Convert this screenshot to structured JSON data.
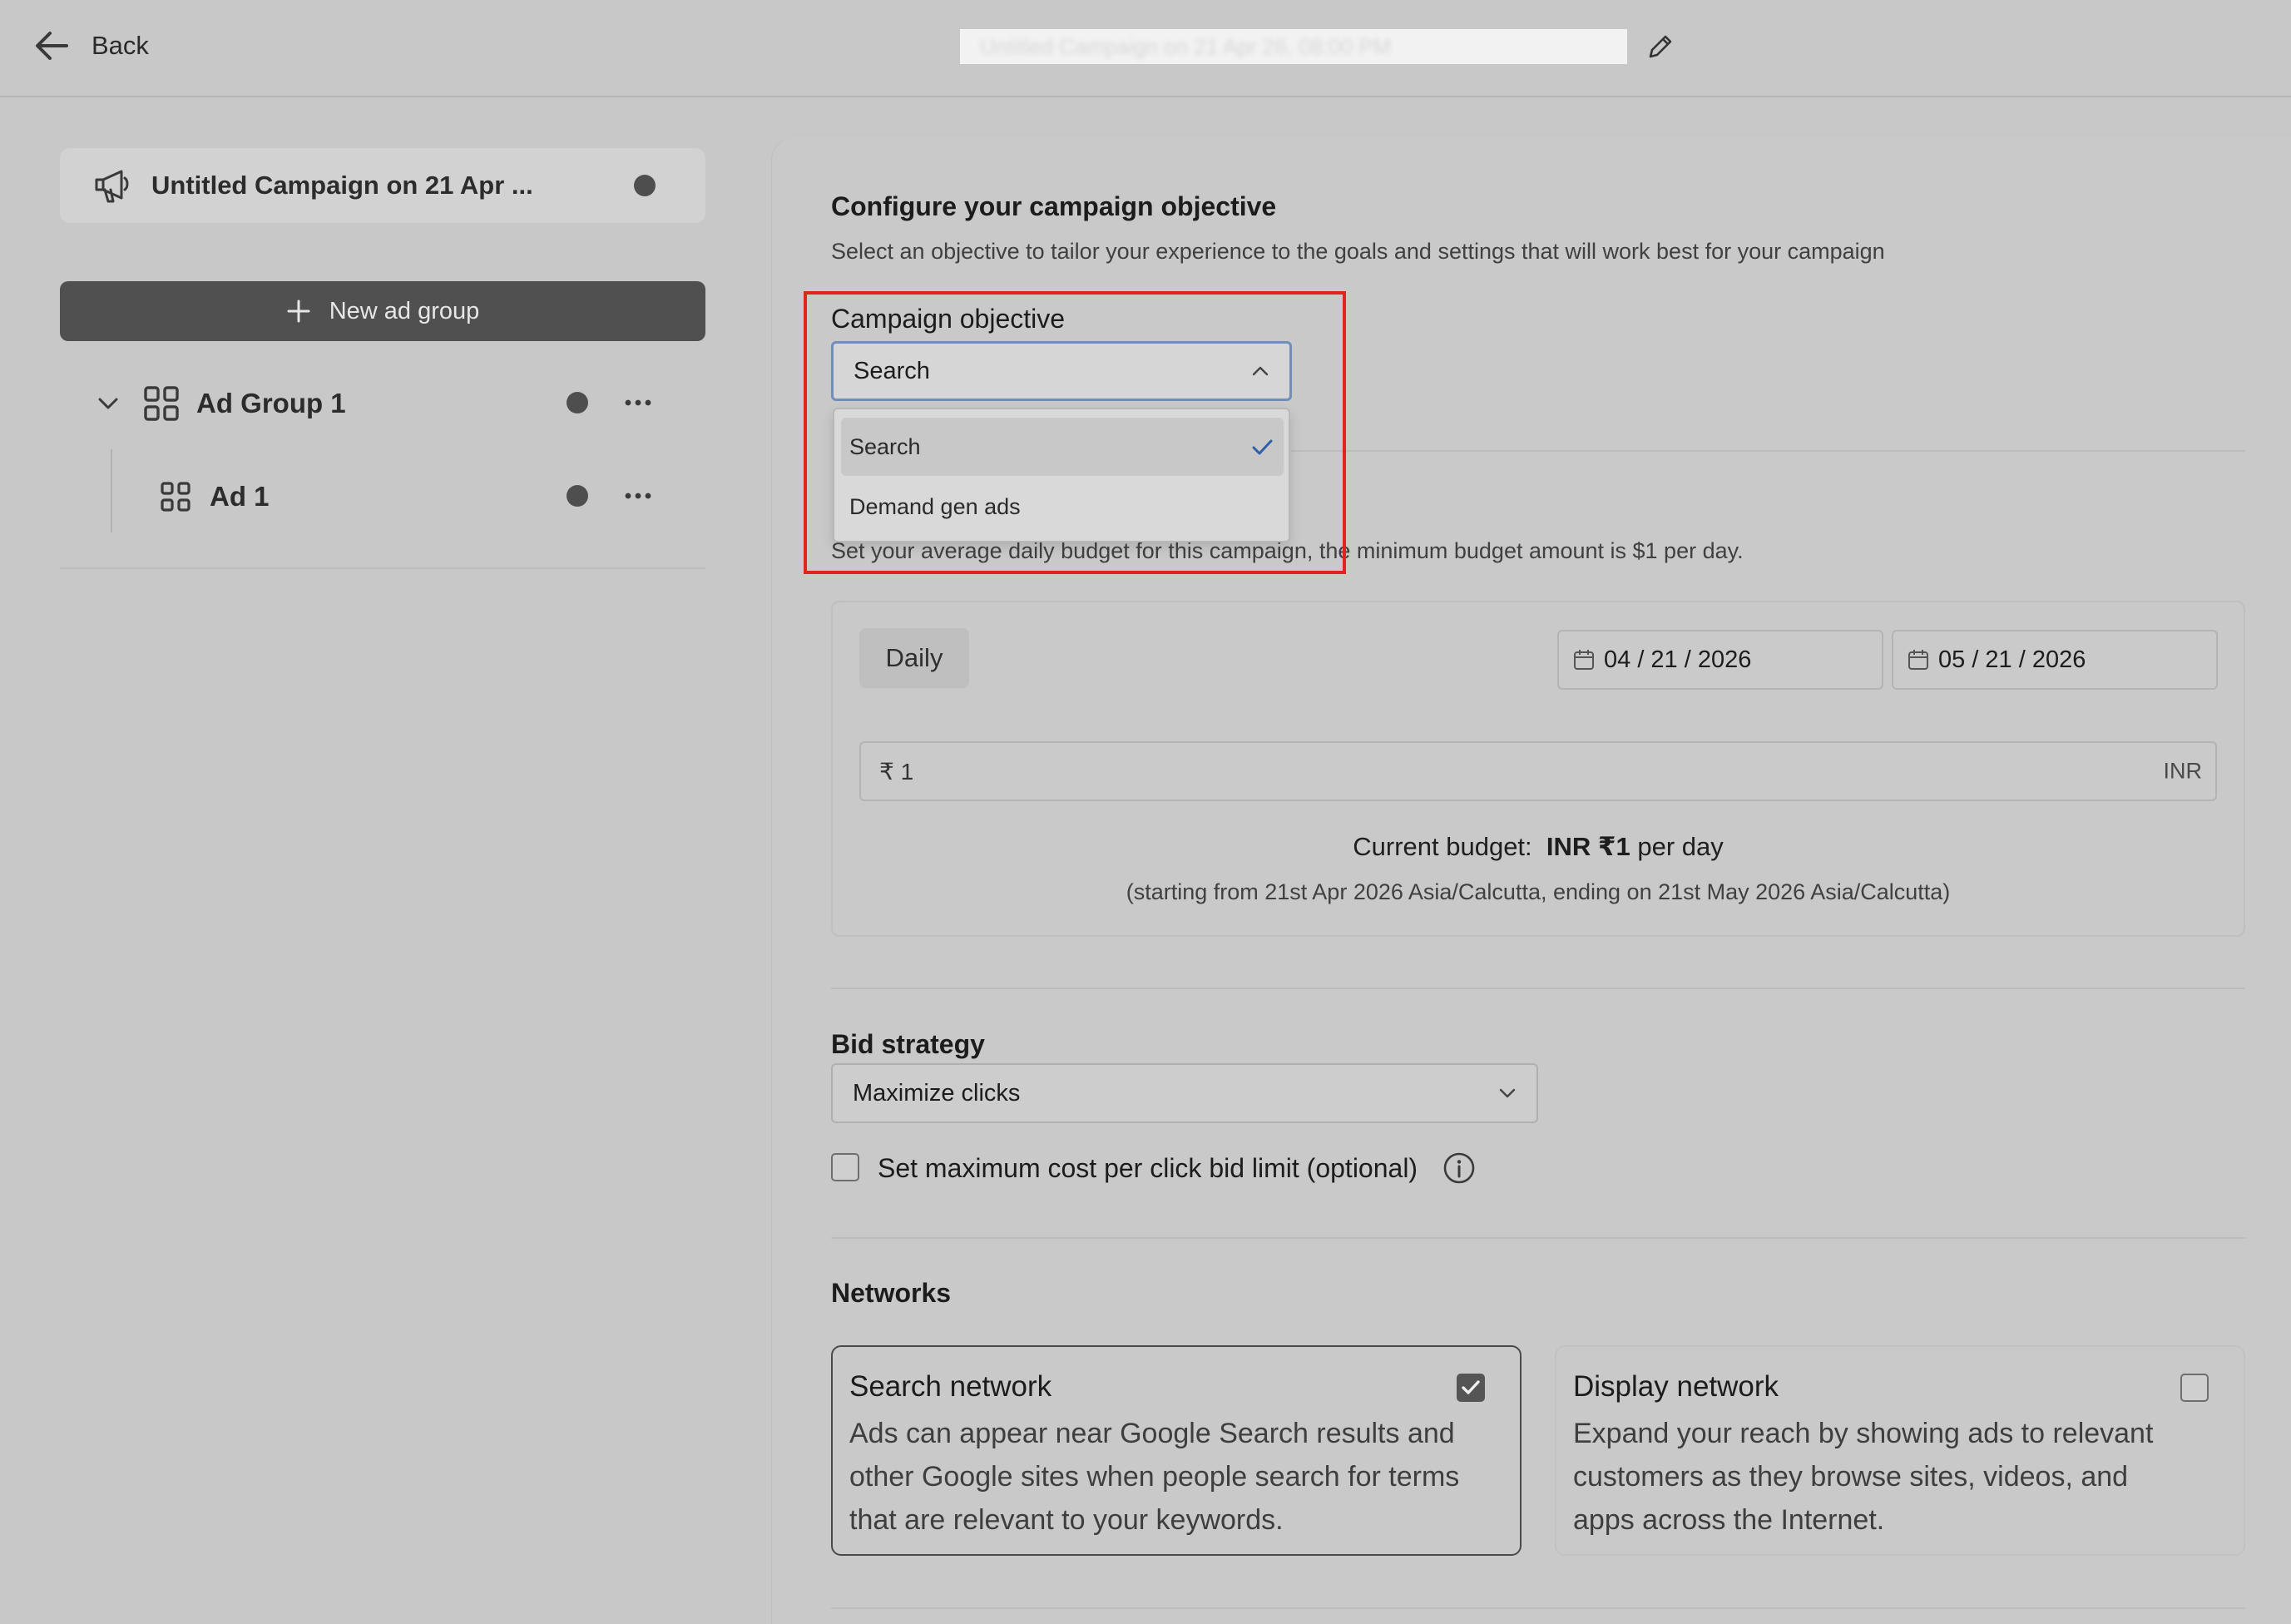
{
  "topbar": {
    "back_label": "Back",
    "blurred_title": "Untitled Campaign on 21 Apr 26, 08:00 PM"
  },
  "sidebar": {
    "campaign_name": "Untitled Campaign on 21 Apr ...",
    "new_ad_group_label": "New ad group",
    "ad_group": {
      "label": "Ad Group 1"
    },
    "ad": {
      "label": "Ad 1"
    }
  },
  "objective": {
    "heading": "Configure your campaign objective",
    "description": "Select an objective to tailor your experience to the goals and settings that will work best for your campaign",
    "field_label": "Campaign objective",
    "selected_value": "Search",
    "options": [
      "Search",
      "Demand gen ads"
    ],
    "selected_option_index": 0
  },
  "budget": {
    "description": "Set your average daily budget for this campaign, the minimum budget amount is $1 per day.",
    "period_label": "Daily",
    "start_date": "04 / 21 / 2026",
    "end_date": "05 / 21 / 2026",
    "amount": "₹ 1",
    "currency": "INR",
    "current_budget_prefix": "Current budget:",
    "current_budget_value": "INR ₹1",
    "current_budget_suffix": "per day",
    "range_note": "(starting from 21st Apr 2026 Asia/Calcutta, ending on 21st May 2026 Asia/Calcutta)"
  },
  "bid": {
    "heading": "Bid strategy",
    "selected_value": "Maximize clicks",
    "max_cpc_label": "Set maximum cost per click bid limit (optional)",
    "max_cpc_checked": false
  },
  "networks": {
    "heading": "Networks",
    "items": [
      {
        "title": "Search network",
        "description": "Ads can appear near Google Search results and other Google sites when people search for terms that are relevant to your keywords.",
        "checked": true
      },
      {
        "title": "Display network",
        "description": "Expand your reach by showing ads to relevant customers as they browse sites, videos, and apps across the Internet.",
        "checked": false
      }
    ]
  },
  "colors": {
    "background": "#c8c8c8",
    "highlight_border": "#e0241b",
    "primary_button": "#505050",
    "check_accent": "#2f5fa8"
  },
  "icons": [
    "arrow-left-icon",
    "pencil-icon",
    "megaphone-icon",
    "plus-icon",
    "chevron-down-icon",
    "grid-icon",
    "more-horizontal-icon",
    "chevron-up-icon",
    "checkmark-icon",
    "calendar-icon",
    "info-icon"
  ]
}
